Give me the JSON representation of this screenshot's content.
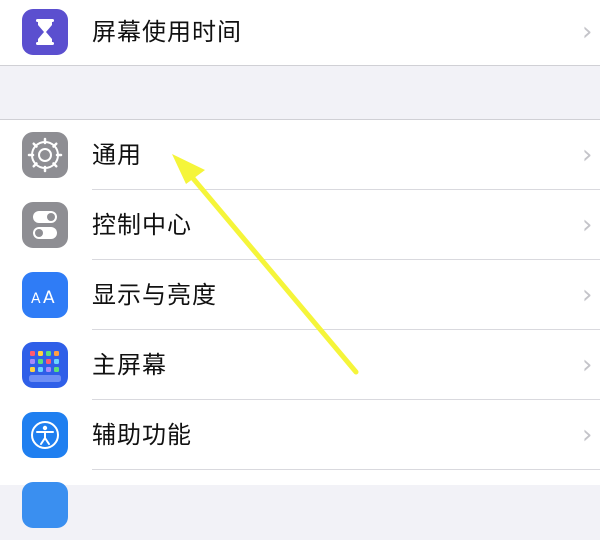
{
  "settings": {
    "items": [
      {
        "label": "屏幕使用时间",
        "icon": "hourglass-icon",
        "color": "#5b4fcf"
      },
      {
        "label": "通用",
        "icon": "gear-icon",
        "color": "#8e8e93"
      },
      {
        "label": "控制中心",
        "icon": "toggles-icon",
        "color": "#8e8e93"
      },
      {
        "label": "显示与亮度",
        "icon": "text-size-icon",
        "color": "#2f7cf6"
      },
      {
        "label": "主屏幕",
        "icon": "app-grid-icon",
        "color": "#2f5fe8"
      },
      {
        "label": "辅助功能",
        "icon": "accessibility-icon",
        "color": "#1f7ff0"
      }
    ],
    "chevron": "›",
    "annotation_color": "#f5f53a"
  }
}
